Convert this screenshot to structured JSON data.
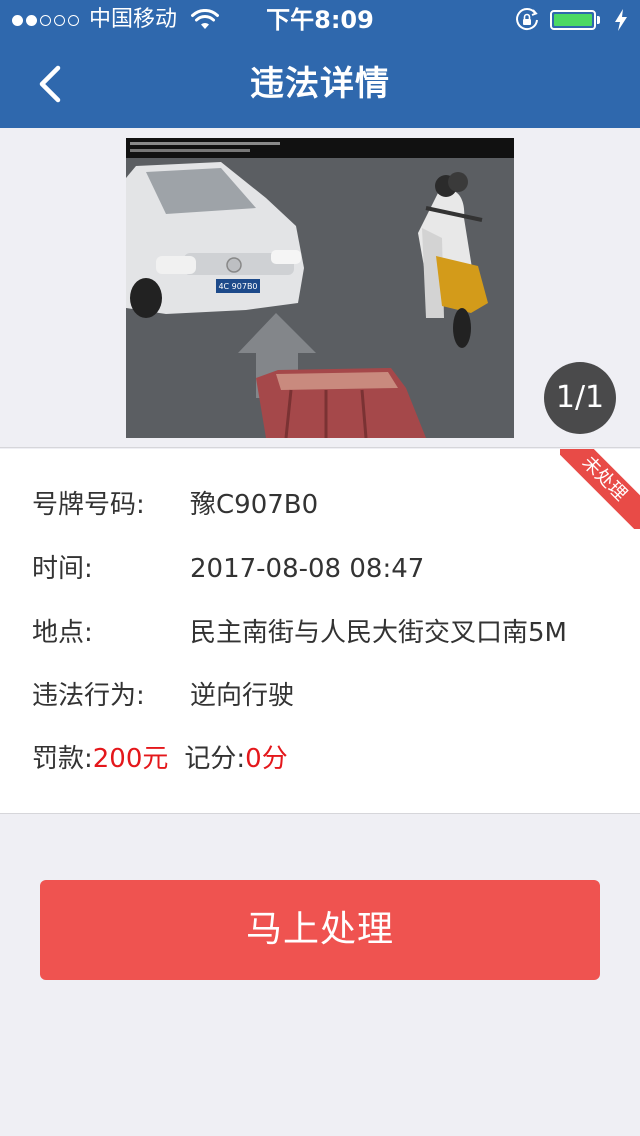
{
  "status_bar": {
    "carrier": "中国移动",
    "time": "下午8:09",
    "signal_bars_filled": 2,
    "signal_bars_total": 5,
    "battery_level": 1.0,
    "battery_color": "#4cd964"
  },
  "nav": {
    "title": "违法详情",
    "back_icon": "chevron-left-icon",
    "bar_color": "#2f68ad"
  },
  "photo": {
    "counter": "1/1",
    "plate_text": "4C 907B0"
  },
  "details": {
    "status_ribbon": "未处理",
    "plate": {
      "label": "号牌号码:",
      "value": "豫C907B0"
    },
    "time": {
      "label": "时间:",
      "value": "2017-08-08 08:47"
    },
    "location": {
      "label": "地点:",
      "value": "民主南街与人民大街交叉口南5M"
    },
    "violation": {
      "label": "违法行为:",
      "value": "逆向行驶"
    },
    "fine": {
      "label": "罚款:",
      "value": "200元"
    },
    "points": {
      "label": "记分:",
      "value": "0分"
    }
  },
  "action": {
    "label": "马上处理",
    "color": "#ef5350"
  }
}
